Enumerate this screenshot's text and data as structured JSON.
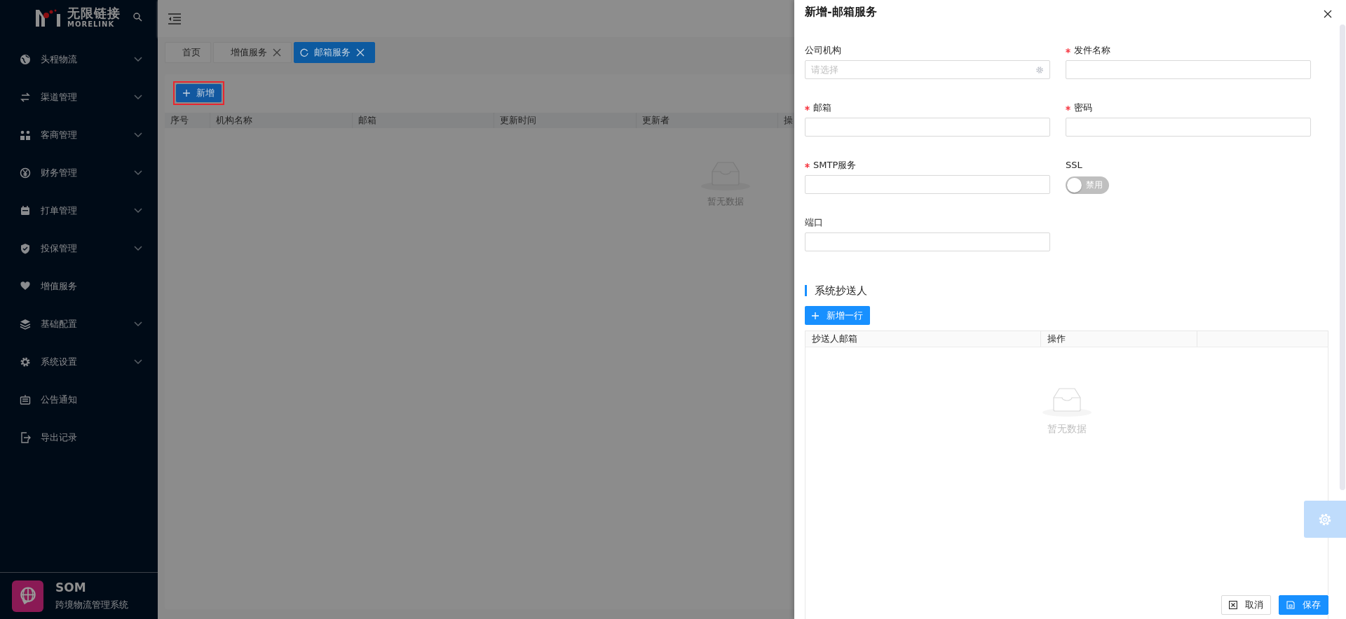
{
  "sidebar": {
    "logo": {
      "name": "无限链接",
      "subtitle": "MORELINK"
    },
    "items": [
      {
        "label": "头程物流",
        "expandable": true
      },
      {
        "label": "渠道管理",
        "expandable": true
      },
      {
        "label": "客商管理",
        "expandable": true
      },
      {
        "label": "财务管理",
        "expandable": true
      },
      {
        "label": "打单管理",
        "expandable": true
      },
      {
        "label": "投保管理",
        "expandable": true
      },
      {
        "label": "增值服务",
        "expandable": false
      },
      {
        "label": "基础配置",
        "expandable": true
      },
      {
        "label": "系统设置",
        "expandable": true
      },
      {
        "label": "公告通知",
        "expandable": false
      },
      {
        "label": "导出记录",
        "expandable": false
      }
    ],
    "footer": {
      "title": "SOM",
      "subtitle": "跨境物流管理系统"
    }
  },
  "tabs": [
    {
      "label": "首页",
      "selected": false,
      "closable": false
    },
    {
      "label": "增值服务",
      "selected": false,
      "closable": true
    },
    {
      "label": "邮箱服务",
      "selected": true,
      "closable": true
    }
  ],
  "toolbar": {
    "add_button": "新增",
    "highlighted": true
  },
  "table": {
    "columns": [
      "序号",
      "机构名称",
      "邮箱",
      "更新时间",
      "更新者",
      "操"
    ],
    "empty_text": "暂无数据"
  },
  "drawer": {
    "title": "新增-邮箱服务",
    "fields": [
      {
        "label": "公司机构",
        "required": false,
        "kind": "select",
        "placeholder": "请选择"
      },
      {
        "label": "发件名称",
        "required": true,
        "kind": "text"
      },
      {
        "label": "邮箱",
        "required": true,
        "kind": "text"
      },
      {
        "label": "密码",
        "required": true,
        "kind": "text"
      },
      {
        "label": "SMTP服务",
        "required": true,
        "kind": "text"
      },
      {
        "label": "SSL",
        "required": false,
        "kind": "switch",
        "on": false,
        "switch_text": "禁用"
      },
      {
        "label": "端口",
        "required": false,
        "kind": "text"
      }
    ],
    "section_title": "系统抄送人",
    "add_row_button": "新增一行",
    "table": {
      "columns": [
        "抄送人邮箱",
        "操作"
      ],
      "empty_text": "暂无数据"
    },
    "buttons": [
      {
        "label": "取消",
        "kind": "cancel"
      },
      {
        "label": "保存",
        "kind": "primary"
      }
    ]
  }
}
